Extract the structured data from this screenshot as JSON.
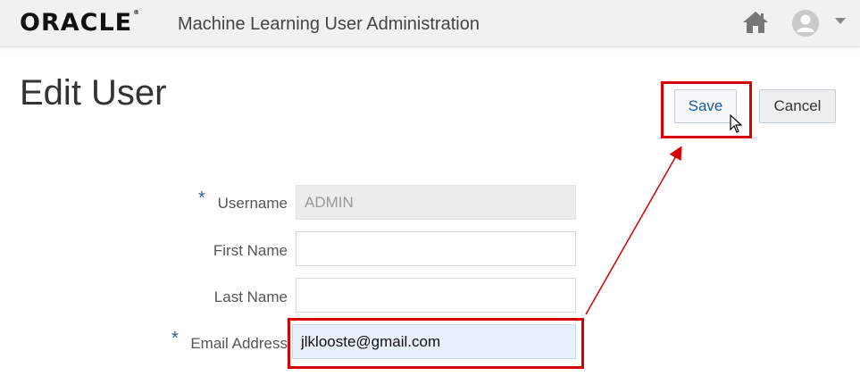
{
  "header": {
    "brand": "ORACLE",
    "brand_mark": "®",
    "app_title": "Machine Learning User Administration",
    "icons": {
      "home": "home-icon",
      "user": "user-avatar-icon",
      "menu": "caret-down-icon"
    }
  },
  "page": {
    "title": "Edit User"
  },
  "toolbar": {
    "save_label": "Save",
    "cancel_label": "Cancel"
  },
  "form": {
    "required_marker": "*",
    "username": {
      "label": "Username",
      "value": "ADMIN",
      "required": true,
      "disabled": true
    },
    "first_name": {
      "label": "First Name",
      "value": ""
    },
    "last_name": {
      "label": "Last Name",
      "value": ""
    },
    "email": {
      "label": "Email Address",
      "value": "jlklooste@gmail.com",
      "required": true
    }
  },
  "annotations": {
    "highlight_color": "#d60000"
  }
}
